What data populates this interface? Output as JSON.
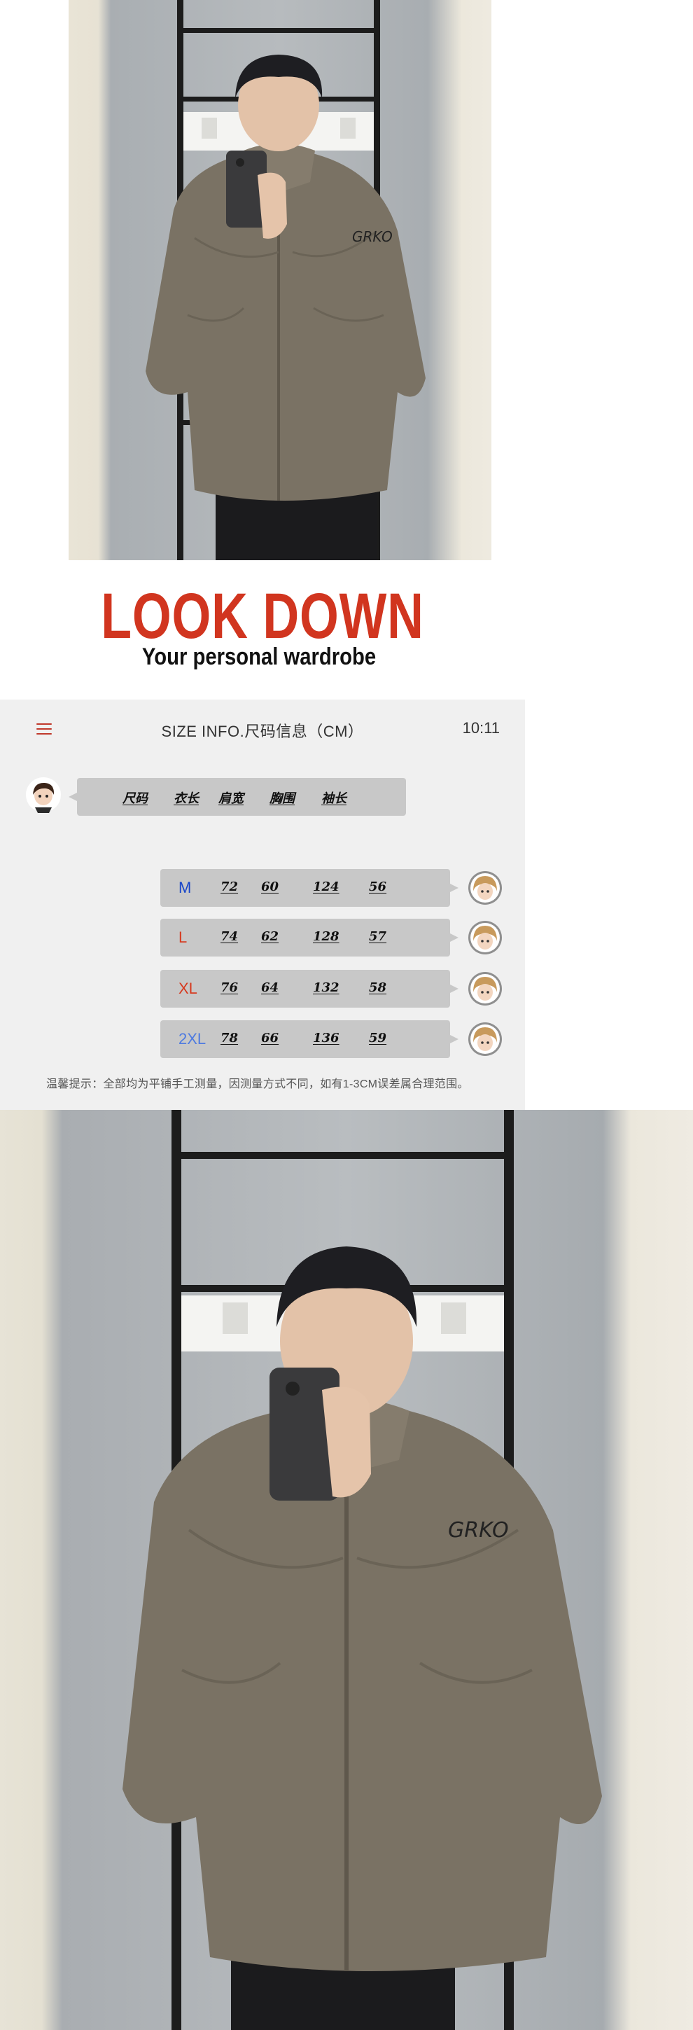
{
  "brand": {
    "title": "LOOK DOWN",
    "subtitle": "Your personal wardrobe",
    "accent": "#d1351f"
  },
  "size_panel": {
    "menu_icon": "hamburger-menu-icon",
    "title": "SIZE INFO.尺码信息（CM）",
    "time": "10:11",
    "headers": [
      "尺码",
      "衣长",
      "肩宽",
      "胸围",
      "袖长"
    ],
    "rows": [
      {
        "size": "M",
        "color": "#1a47c9",
        "values": [
          "72",
          "60",
          "124",
          "56"
        ]
      },
      {
        "size": "L",
        "color": "#d63a1f",
        "values": [
          "74",
          "62",
          "128",
          "57"
        ]
      },
      {
        "size": "XL",
        "color": "#d63a1f",
        "values": [
          "76",
          "64",
          "132",
          "58"
        ]
      },
      {
        "size": "2XL",
        "color": "#4f7be0",
        "values": [
          "78",
          "66",
          "136",
          "59"
        ]
      }
    ],
    "tip": "温馨提示：全部均为平铺手工测量，因测量方式不同，如有1-3CM误差属合理范围。"
  }
}
